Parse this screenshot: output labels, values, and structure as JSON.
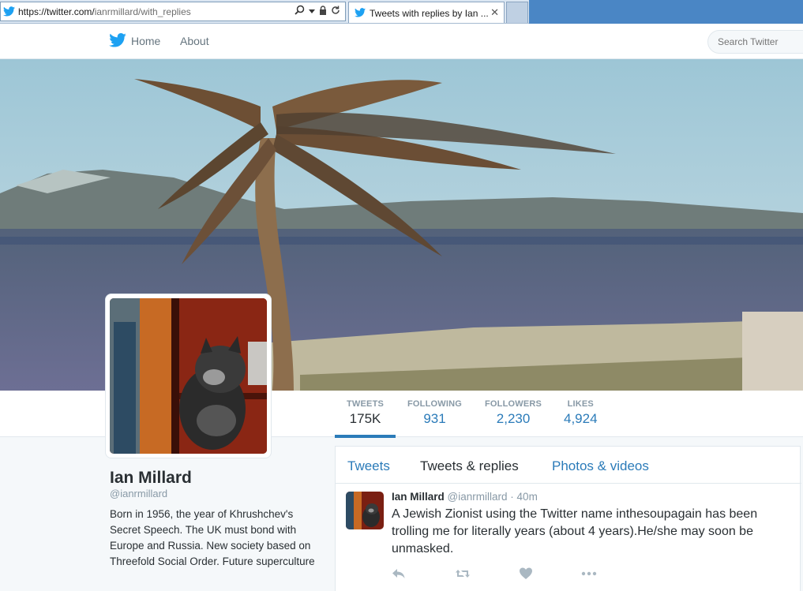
{
  "browser": {
    "url_host": "https://twitter.com/",
    "url_path": "ianrmillard/with_replies",
    "tab_title": "Tweets with replies by Ian ..."
  },
  "nav": {
    "home": "Home",
    "about": "About",
    "search_placeholder": "Search Twitter"
  },
  "stats": [
    {
      "label": "TWEETS",
      "value": "175K"
    },
    {
      "label": "FOLLOWING",
      "value": "931"
    },
    {
      "label": "FOLLOWERS",
      "value": "2,230"
    },
    {
      "label": "LIKES",
      "value": "4,924"
    }
  ],
  "profile": {
    "name": "Ian Millard",
    "handle": "@ianrmillard",
    "bio": "Born in 1956, the year of Khrushchev's Secret Speech. The UK must bond with Europe and Russia. New society based on Threefold Social Order. Future superculture"
  },
  "timeline_tabs": [
    "Tweets",
    "Tweets & replies",
    "Photos & videos"
  ],
  "tweet": {
    "name": "Ian Millard",
    "handle": "@ianrmillard",
    "dot": "·",
    "time": "40m",
    "text": "A Jewish Zionist using the Twitter name inthesoupagain has been trolling me for literally years (about 4 years).He/she may soon be unmasked."
  },
  "colors": {
    "link": "#2b7bb9",
    "twitter_blue": "#1da1f2",
    "muted": "#8899a6",
    "text": "#292f33"
  },
  "icons": [
    "twitter-bird-icon",
    "search-icon",
    "dropdown-icon",
    "lock-icon",
    "refresh-icon",
    "close-icon",
    "reply-icon",
    "retweet-icon",
    "like-icon",
    "more-icon"
  ]
}
